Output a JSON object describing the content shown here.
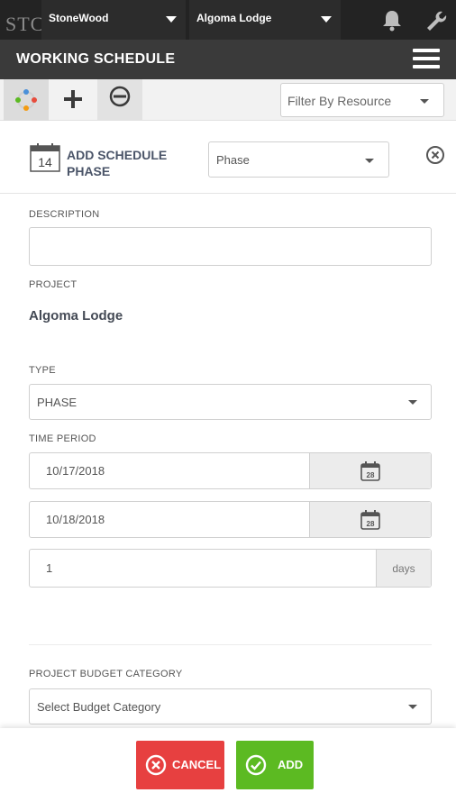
{
  "topbar": {
    "logo_text": "STC",
    "company": "StoneWood",
    "project": "Algoma Lodge",
    "icons": [
      "bell-icon",
      "wrench-icon"
    ]
  },
  "titlebar": {
    "title": "WORKING SCHEDULE",
    "menu_icon": "hamburger-icon"
  },
  "toolbar": {
    "tools": [
      "schedule-view-icon",
      "add-icon",
      "link-icon"
    ],
    "filter_placeholder": "Filter By Resource"
  },
  "modal": {
    "calendar_icon_day": "14",
    "title": "ADD SCHEDULE PHASE",
    "phase_value": "Phase",
    "close_icon": "close-circle-icon"
  },
  "form": {
    "description_label": "DESCRIPTION",
    "description_value": "",
    "project_label": "PROJECT",
    "project_value": "Algoma Lodge",
    "type_label": "TYPE",
    "type_value": "PHASE",
    "time_period_label": "TIME PERIOD",
    "start_date": "10/17/2018",
    "end_date": "10/18/2018",
    "calendar_day": "28",
    "duration": "1",
    "duration_unit": "days",
    "budget_label": "PROJECT BUDGET CATEGORY",
    "budget_placeholder": "Select Budget Category"
  },
  "footer": {
    "cancel_label": "CANCEL",
    "add_label": "ADD"
  },
  "colors": {
    "topbar": "#232323",
    "titlebar": "#3a3a3a",
    "cancel": "#e74040",
    "add": "#5cba22",
    "heading": "#4a5468"
  }
}
